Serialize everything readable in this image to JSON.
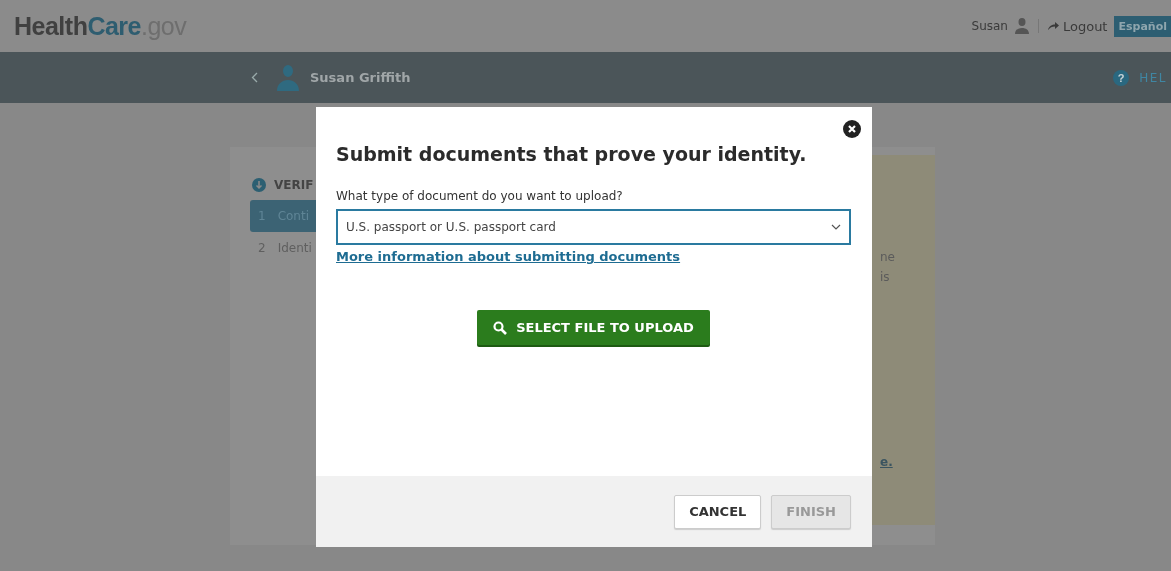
{
  "header": {
    "logo": [
      "Health",
      "Care",
      ".gov"
    ],
    "user": "Susan",
    "logout": "Logout",
    "language": "Español"
  },
  "nav": {
    "person": "Susan Griffith",
    "help_icon": "?",
    "help": "HEL"
  },
  "steps": {
    "heading": "VERIF",
    "items": [
      {
        "number": "1",
        "label": "Conti",
        "selected": true
      },
      {
        "number": "2",
        "label": "Identi",
        "selected": false
      }
    ]
  },
  "side_panel": {
    "lines": [
      "ne",
      "is"
    ],
    "link": "e."
  },
  "dialog": {
    "title": "Submit documents that prove your identity.",
    "question": "What type of document do you want to upload?",
    "document_type": "U.S. passport or U.S. passport card",
    "info_link": "More information about submitting documents",
    "upload_button": "SELECT FILE TO UPLOAD",
    "cancel_button": "CANCEL",
    "finish_button": {
      "label": "FINISH",
      "disabled": true
    }
  }
}
